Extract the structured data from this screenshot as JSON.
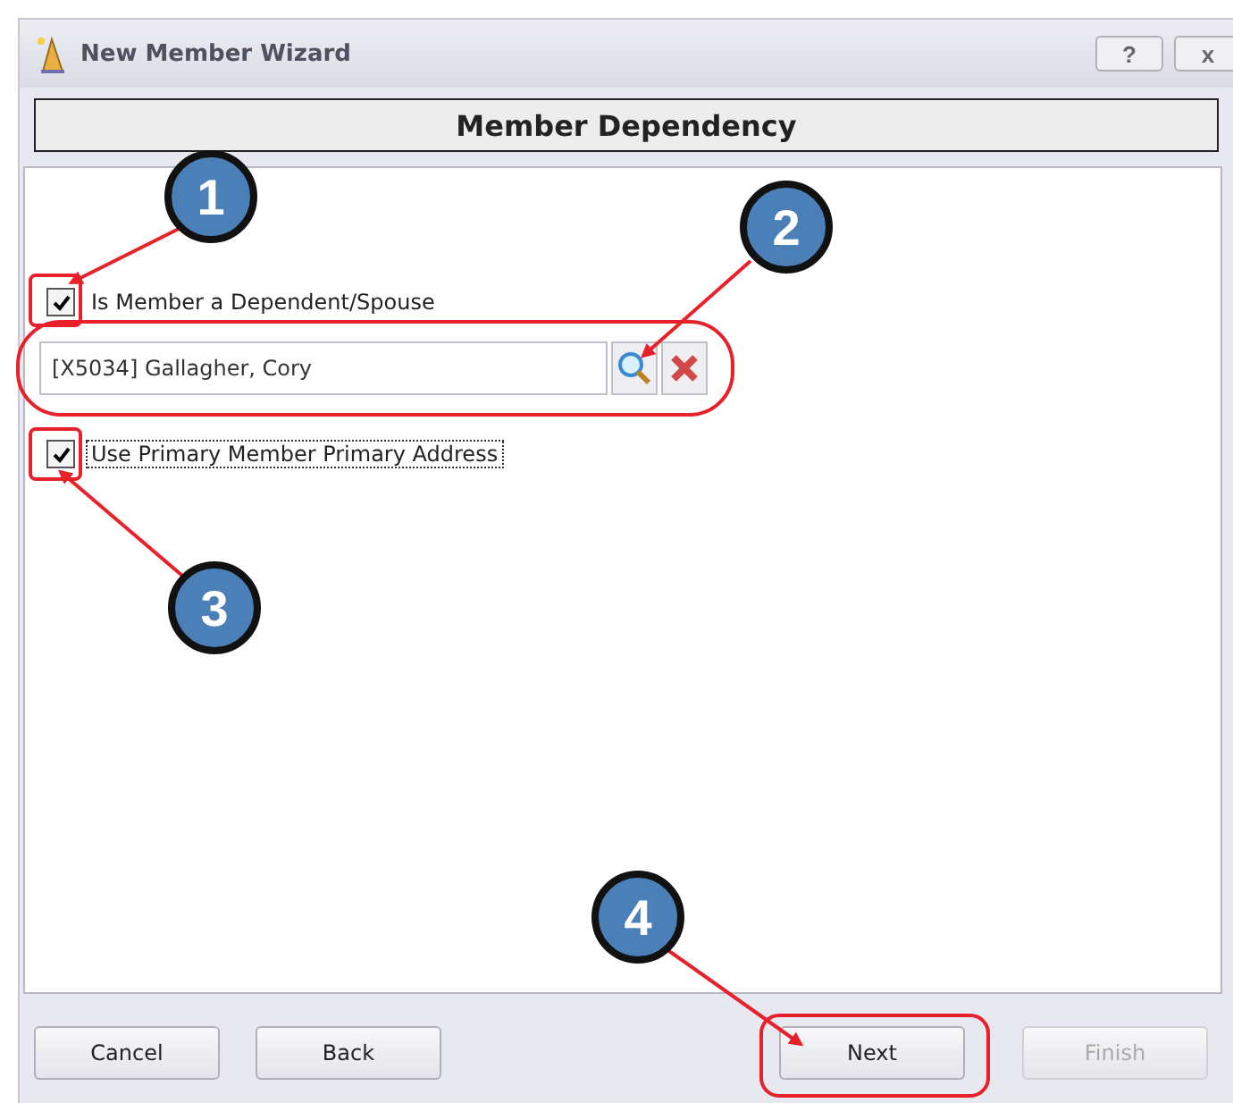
{
  "window": {
    "title": "New Member Wizard",
    "controls": [
      "?",
      "x"
    ]
  },
  "heading": "Member Dependency",
  "fields": [
    {
      "kind": "checkbox",
      "label": "Is Member a Dependent/Spouse",
      "checked": true,
      "focused": false
    },
    {
      "kind": "lookup",
      "value": "[X5034] Gallagher, Cory"
    },
    {
      "kind": "checkbox",
      "label": "Use Primary Member Primary Address",
      "checked": true,
      "focused": true
    }
  ],
  "buttons": [
    {
      "label": "Cancel",
      "disabled": false
    },
    {
      "label": "Back",
      "disabled": false
    },
    {
      "label": "Next",
      "disabled": false
    },
    {
      "label": "Finish",
      "disabled": true
    }
  ],
  "callouts": [
    "1",
    "2",
    "3",
    "4"
  ]
}
